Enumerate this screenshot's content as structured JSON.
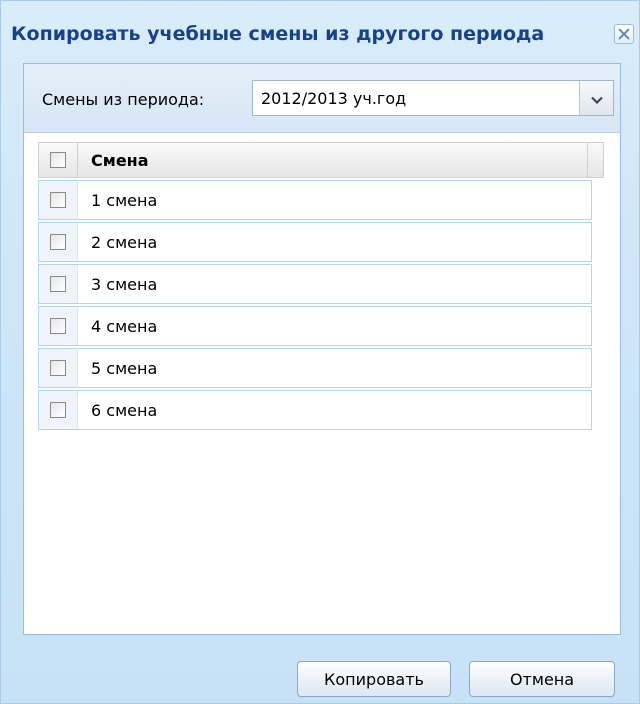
{
  "dialog": {
    "title": "Копировать учебные смены из другого периода",
    "close_icon": "close-icon"
  },
  "filter": {
    "label": "Смены из периода:",
    "selected_period": "2012/2013 уч.год",
    "dropdown_icon": "chevron-down-icon"
  },
  "grid": {
    "column_header": "Смена",
    "rows": [
      {
        "label": "1 смена",
        "checked": false
      },
      {
        "label": "2 смена",
        "checked": false
      },
      {
        "label": "3 смена",
        "checked": false
      },
      {
        "label": "4 смена",
        "checked": false
      },
      {
        "label": "5 смена",
        "checked": false
      },
      {
        "label": "6 смена",
        "checked": false
      }
    ]
  },
  "buttons": {
    "copy_label": "Копировать",
    "cancel_label": "Отмена"
  },
  "colors": {
    "title_text": "#15428b",
    "window_bg": "#cfe6f8",
    "row_border": "#b0d8ec",
    "panel_border": "#99bbe8"
  }
}
